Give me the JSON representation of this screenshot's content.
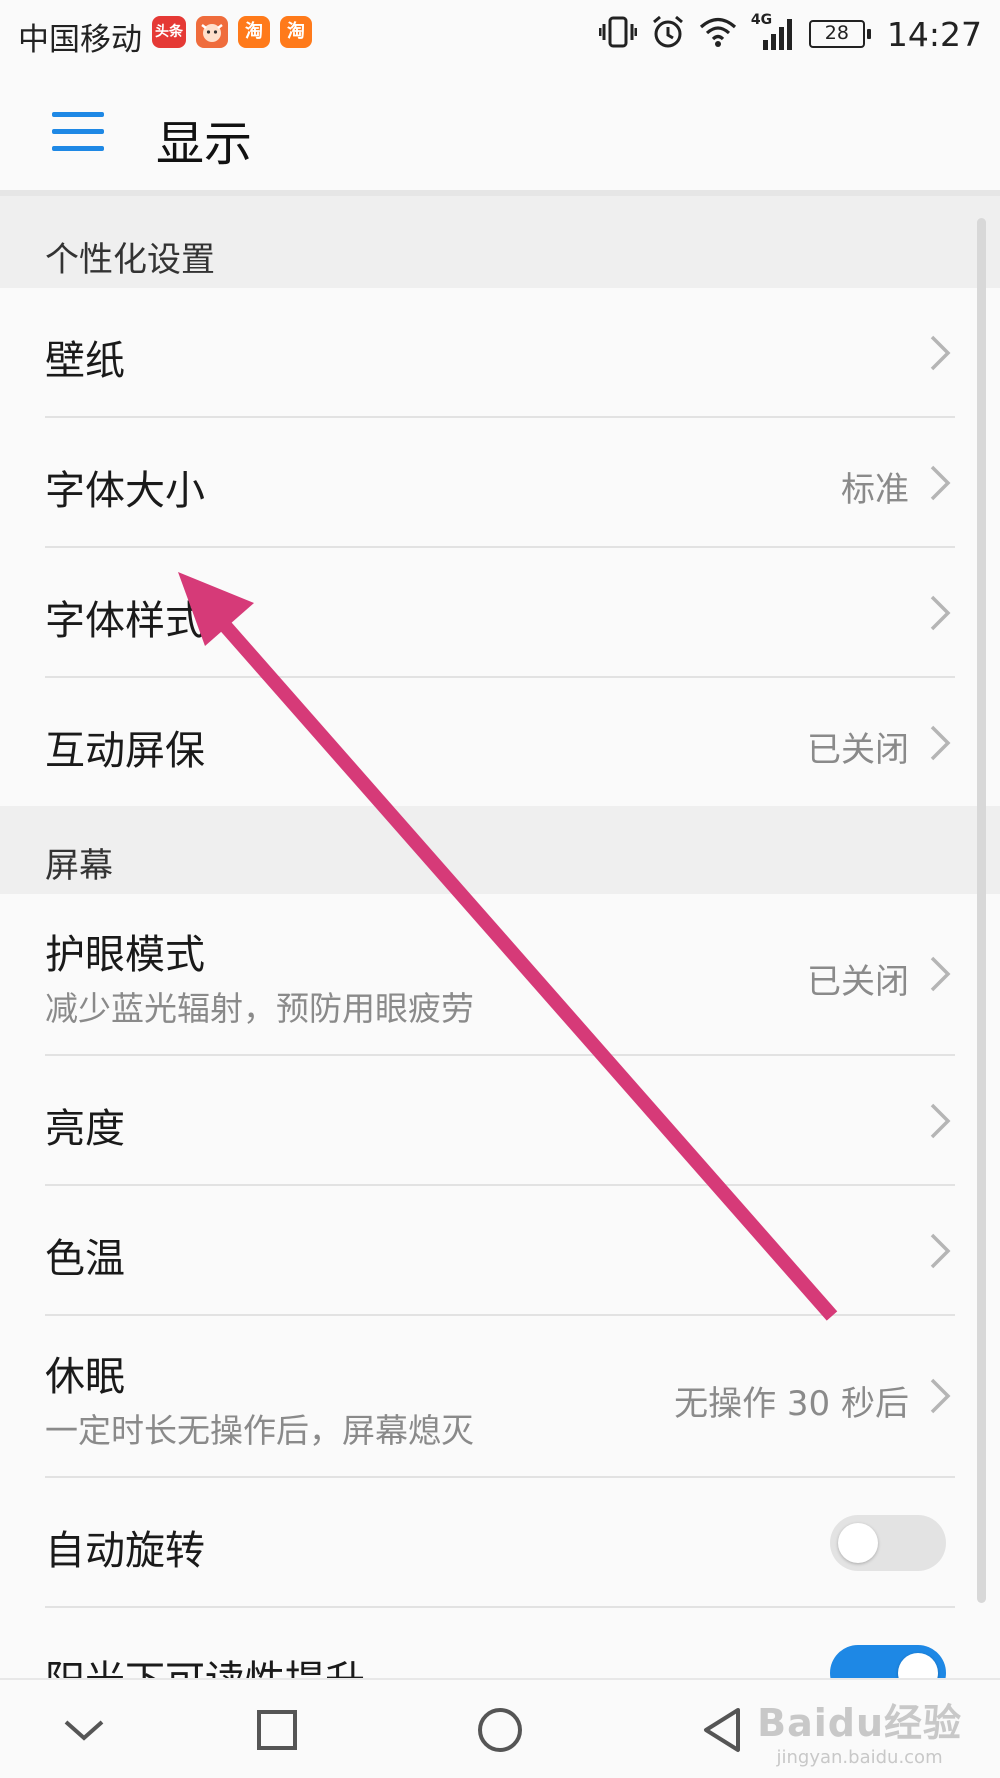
{
  "status_bar": {
    "carrier": "中国移动",
    "app_badges": [
      "头条",
      "淘",
      "淘"
    ],
    "network": "4G",
    "battery": "28",
    "time": "14:27"
  },
  "header": {
    "title": "显示"
  },
  "sections": [
    {
      "title": "个性化设置"
    },
    {
      "title": "屏幕"
    }
  ],
  "rows": {
    "wallpaper": {
      "title": "壁纸"
    },
    "font_size": {
      "title": "字体大小",
      "value": "标准"
    },
    "font_style": {
      "title": "字体样式"
    },
    "screensaver": {
      "title": "互动屏保",
      "value": "已关闭"
    },
    "eye_comfort": {
      "title": "护眼模式",
      "subtitle": "减少蓝光辐射，预防用眼疲劳",
      "value": "已关闭"
    },
    "brightness": {
      "title": "亮度"
    },
    "color_temp": {
      "title": "色温"
    },
    "sleep": {
      "title": "休眠",
      "subtitle": "一定时长无操作后，屏幕熄灭",
      "value": "无操作 30 秒后"
    },
    "auto_rotate": {
      "title": "自动旋转",
      "toggle": false
    },
    "sunlight": {
      "title": "阳光下可读性提升",
      "toggle": true
    }
  },
  "watermark": {
    "main": "Baidu经验",
    "sub": "jingyan.baidu.com"
  },
  "colors": {
    "accent": "#1e88e5",
    "annotation_arrow": "#d63a78",
    "toggle_off": "#e3e3e3"
  }
}
